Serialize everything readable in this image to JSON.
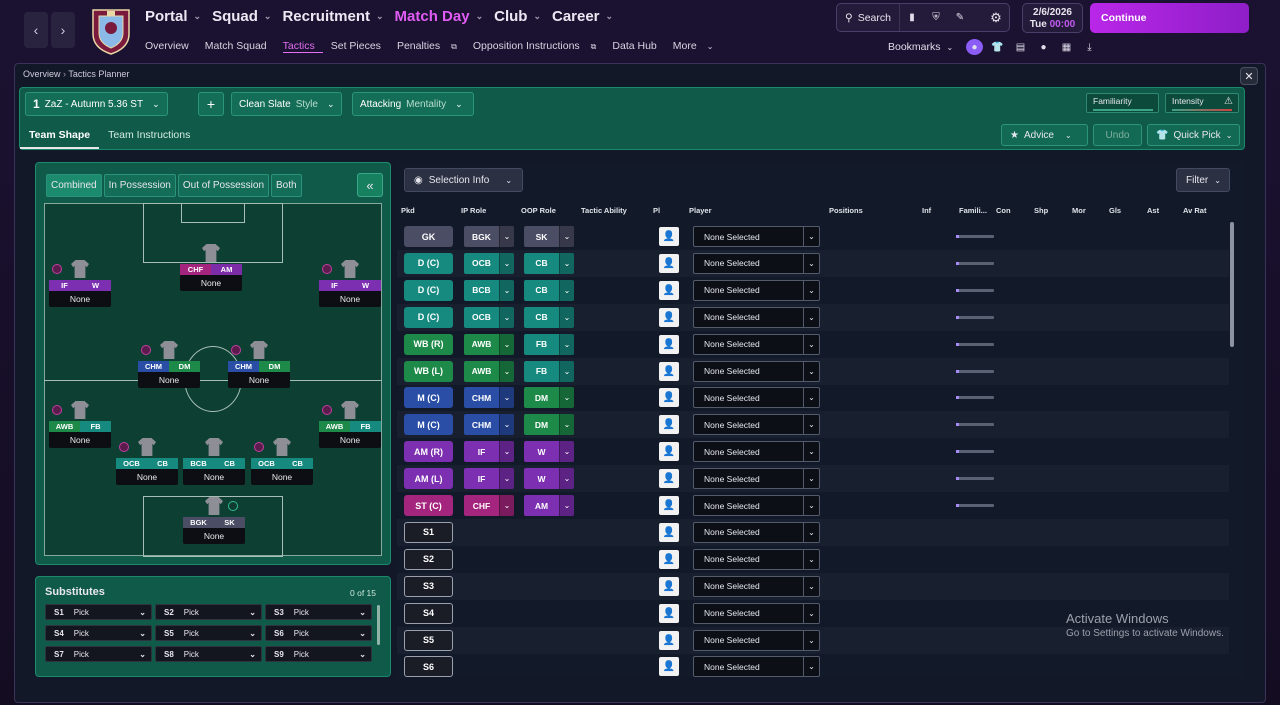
{
  "topnav": {
    "items": [
      "Portal",
      "Squad",
      "Recruitment",
      "Match Day",
      "Club",
      "Career"
    ],
    "active": "Match Day"
  },
  "subnav": {
    "items": [
      "Overview",
      "Match Squad",
      "Tactics",
      "Set Pieces",
      "Penalties",
      "Opposition Instructions",
      "Data Hub",
      "More"
    ],
    "active": "Tactics"
  },
  "toolbar": {
    "search": "Search"
  },
  "date": {
    "date": "2/6/2026",
    "day": "Tue",
    "time": "00:00"
  },
  "continue_label": "Continue",
  "bookmarks_label": "Bookmarks",
  "breadcrumb": [
    "Overview",
    "Tactics Planner"
  ],
  "tactic": {
    "slot": "1",
    "name": "ZaZ - Autumn 5.36 ST",
    "style_value": "Clean Slate",
    "style_label": "Style",
    "mentality_value": "Attacking",
    "mentality_label": "Mentality",
    "familiarity_label": "Familiarity",
    "intensity_label": "Intensity"
  },
  "tabs": [
    "Team Shape",
    "Team Instructions"
  ],
  "actions": {
    "advice": "Advice",
    "undo": "Undo",
    "quick_pick": "Quick Pick"
  },
  "view_tabs": [
    "Combined",
    "In Possession",
    "Out of Possession",
    "Both"
  ],
  "pitch_positions": [
    {
      "id": "st",
      "r1": "CHF",
      "r2": "AM",
      "name": "None",
      "c1": "#a3257d",
      "c2": "#7d2ca8"
    },
    {
      "id": "amr",
      "r1": "IF",
      "r2": "W",
      "name": "None",
      "c1": "#7c2fb0",
      "c2": "#7c2fb0"
    },
    {
      "id": "aml",
      "r1": "IF",
      "r2": "W",
      "name": "None",
      "c1": "#7c2fb0",
      "c2": "#7c2fb0"
    },
    {
      "id": "mcl",
      "r1": "CHM",
      "r2": "DM",
      "name": "None",
      "c1": "#2a4ea6",
      "c2": "#1e8a4a"
    },
    {
      "id": "mcr",
      "r1": "CHM",
      "r2": "DM",
      "name": "None",
      "c1": "#2a4ea6",
      "c2": "#1e8a4a"
    },
    {
      "id": "wbl",
      "r1": "AWB",
      "r2": "FB",
      "name": "None",
      "c1": "#1e8a4a",
      "c2": "#178a80"
    },
    {
      "id": "wbr",
      "r1": "AWB",
      "r2": "FB",
      "name": "None",
      "c1": "#1e8a4a",
      "c2": "#178a80"
    },
    {
      "id": "dcl",
      "r1": "OCB",
      "r2": "CB",
      "name": "None",
      "c1": "#178a80",
      "c2": "#178a80"
    },
    {
      "id": "dc",
      "r1": "BCB",
      "r2": "CB",
      "name": "None",
      "c1": "#178a80",
      "c2": "#178a80"
    },
    {
      "id": "dcr",
      "r1": "OCB",
      "r2": "CB",
      "name": "None",
      "c1": "#178a80",
      "c2": "#178a80"
    },
    {
      "id": "gk",
      "r1": "BGK",
      "r2": "SK",
      "name": "None",
      "c1": "#4a4d63",
      "c2": "#4a4d63"
    }
  ],
  "substitutes": {
    "title": "Substitutes",
    "count": "0 of 15",
    "slots": [
      {
        "n": "S1",
        "v": "Pick"
      },
      {
        "n": "S2",
        "v": "Pick"
      },
      {
        "n": "S3",
        "v": "Pick"
      },
      {
        "n": "S4",
        "v": "Pick"
      },
      {
        "n": "S5",
        "v": "Pick"
      },
      {
        "n": "S6",
        "v": "Pick"
      },
      {
        "n": "S7",
        "v": "Pick"
      },
      {
        "n": "S8",
        "v": "Pick"
      },
      {
        "n": "S9",
        "v": "Pick"
      }
    ]
  },
  "selection_info": "Selection Info",
  "filter": "Filter",
  "columns": [
    "Pkd",
    "IP Role",
    "OOP Role",
    "Tactic Ability",
    "Pl",
    "Player",
    "Positions",
    "Inf",
    "Famili...",
    "Con",
    "Shp",
    "Mor",
    "Gls",
    "Ast",
    "Av Rat"
  ],
  "rows": [
    {
      "pos": "GK",
      "ip": "BGK",
      "oop": "SK",
      "player": "None Selected",
      "pc": "#4a4d63",
      "ipc": "#4a4d63",
      "oopc": "#4a4d63"
    },
    {
      "pos": "D (C)",
      "ip": "OCB",
      "oop": "CB",
      "player": "None Selected",
      "pc": "#178a80",
      "ipc": "#178a80",
      "oopc": "#178a80"
    },
    {
      "pos": "D (C)",
      "ip": "BCB",
      "oop": "CB",
      "player": "None Selected",
      "pc": "#178a80",
      "ipc": "#178a80",
      "oopc": "#178a80"
    },
    {
      "pos": "D (C)",
      "ip": "OCB",
      "oop": "CB",
      "player": "None Selected",
      "pc": "#178a80",
      "ipc": "#178a80",
      "oopc": "#178a80"
    },
    {
      "pos": "WB (R)",
      "ip": "AWB",
      "oop": "FB",
      "player": "None Selected",
      "pc": "#1e8a4a",
      "ipc": "#1e8a4a",
      "oopc": "#178a80"
    },
    {
      "pos": "WB (L)",
      "ip": "AWB",
      "oop": "FB",
      "player": "None Selected",
      "pc": "#1e8a4a",
      "ipc": "#1e8a4a",
      "oopc": "#178a80"
    },
    {
      "pos": "M (C)",
      "ip": "CHM",
      "oop": "DM",
      "player": "None Selected",
      "pc": "#2a4ea6",
      "ipc": "#2a4ea6",
      "oopc": "#1e8a4a"
    },
    {
      "pos": "M (C)",
      "ip": "CHM",
      "oop": "DM",
      "player": "None Selected",
      "pc": "#2a4ea6",
      "ipc": "#2a4ea6",
      "oopc": "#1e8a4a"
    },
    {
      "pos": "AM (R)",
      "ip": "IF",
      "oop": "W",
      "player": "None Selected",
      "pc": "#7c2fb0",
      "ipc": "#7c2fb0",
      "oopc": "#7c2fb0"
    },
    {
      "pos": "AM (L)",
      "ip": "IF",
      "oop": "W",
      "player": "None Selected",
      "pc": "#7c2fb0",
      "ipc": "#7c2fb0",
      "oopc": "#7c2fb0"
    },
    {
      "pos": "ST (C)",
      "ip": "CHF",
      "oop": "AM",
      "player": "None Selected",
      "pc": "#a3257d",
      "ipc": "#a3257d",
      "oopc": "#7c2fb0"
    },
    {
      "pos": "S1",
      "player": "None Selected"
    },
    {
      "pos": "S2",
      "player": "None Selected"
    },
    {
      "pos": "S3",
      "player": "None Selected"
    },
    {
      "pos": "S4",
      "player": "None Selected"
    },
    {
      "pos": "S5",
      "player": "None Selected"
    },
    {
      "pos": "S6",
      "player": "None Selected"
    }
  ],
  "watermark": {
    "line1": "Activate Windows",
    "line2": "Go to Settings to activate Windows."
  }
}
